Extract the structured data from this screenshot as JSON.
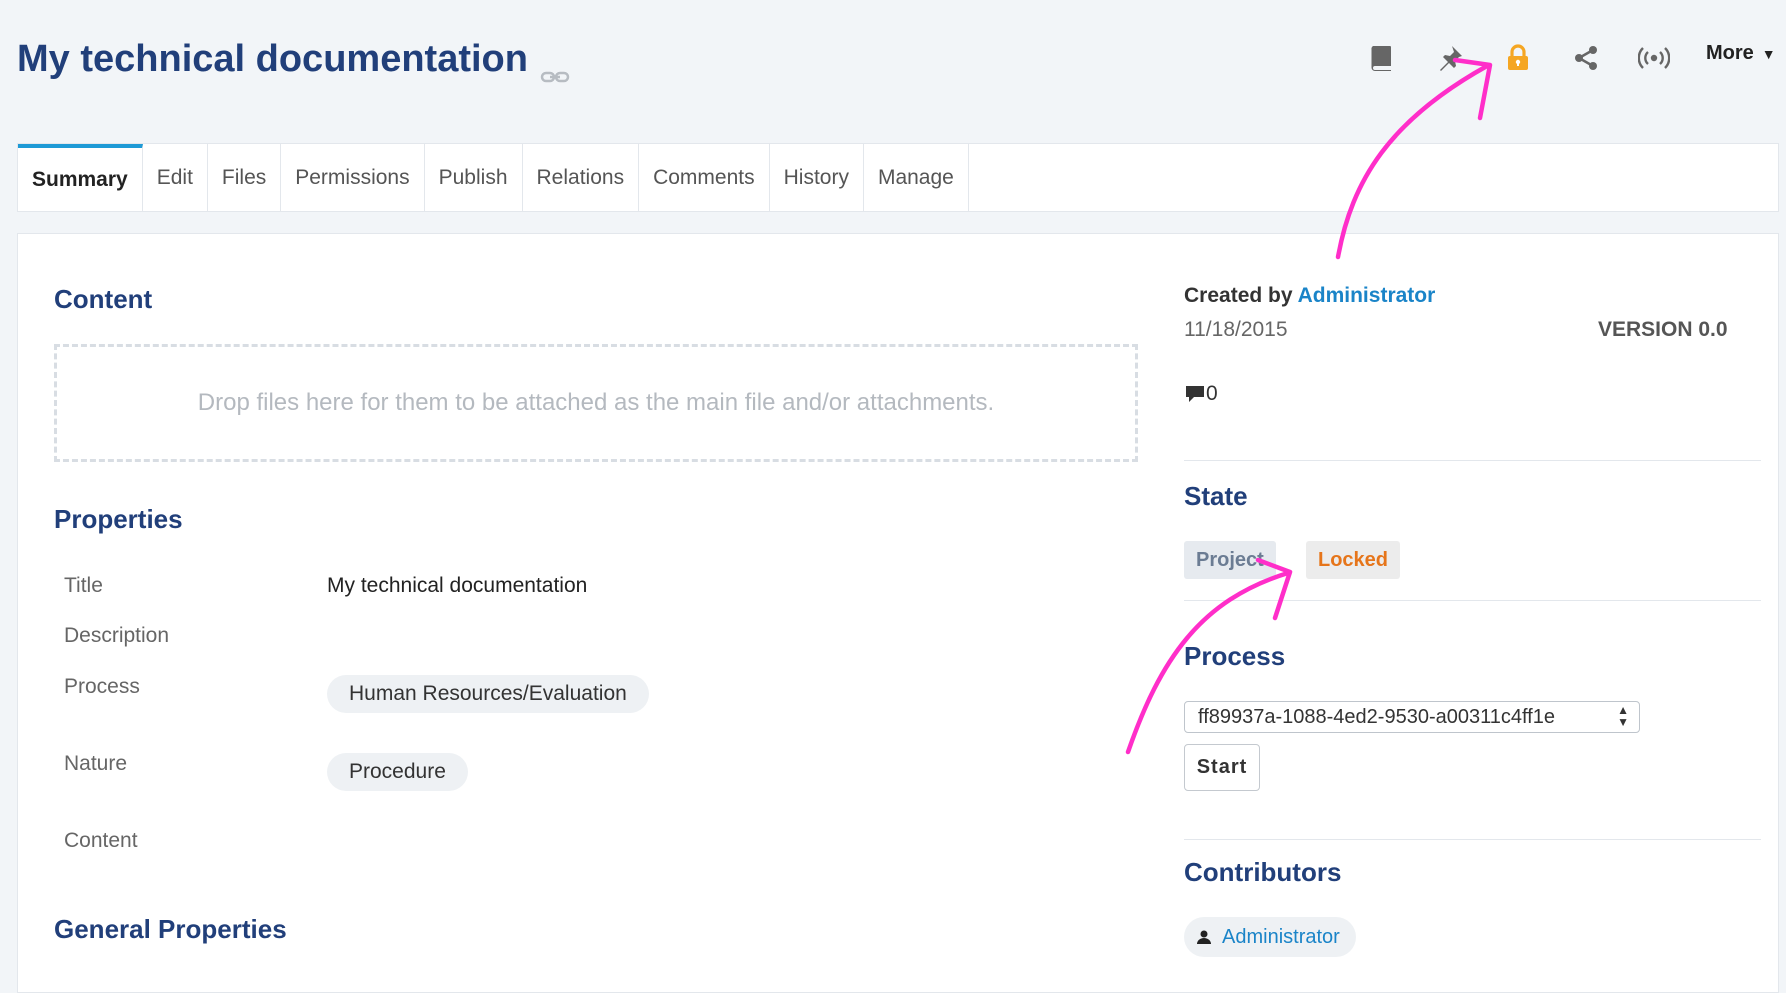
{
  "header": {
    "title": "My technical documentation",
    "more_label": "More"
  },
  "tabs": [
    {
      "label": "Summary",
      "active": true
    },
    {
      "label": "Edit"
    },
    {
      "label": "Files"
    },
    {
      "label": "Permissions"
    },
    {
      "label": "Publish"
    },
    {
      "label": "Relations"
    },
    {
      "label": "Comments"
    },
    {
      "label": "History"
    },
    {
      "label": "Manage"
    }
  ],
  "content": {
    "heading": "Content",
    "dropzone_text": "Drop files here for them to be attached as the main file and/or attachments."
  },
  "properties": {
    "heading": "Properties",
    "title_label": "Title",
    "title_value": "My technical documentation",
    "description_label": "Description",
    "process_label": "Process",
    "process_value": "Human Resources/Evaluation",
    "nature_label": "Nature",
    "nature_value": "Procedure",
    "content_label": "Content"
  },
  "general_properties": {
    "heading": "General Properties"
  },
  "info": {
    "created_by_label": "Created by",
    "created_by_user": "Administrator",
    "date": "11/18/2015",
    "version": "VERSION 0.0",
    "comment_count": "0"
  },
  "state": {
    "heading": "State",
    "badges": [
      "Project",
      "Locked"
    ]
  },
  "process": {
    "heading": "Process",
    "selected": "ff89937a-1088-4ed2-9530-a00311c4ff1e",
    "start_label": "Start"
  },
  "contributors": {
    "heading": "Contributors",
    "items": [
      "Administrator"
    ]
  },
  "icons": {
    "toolbar": [
      "book-icon",
      "pin-icon",
      "lock-icon",
      "share-icon",
      "broadcast-icon"
    ],
    "lock_color": "#f5a623",
    "annotation_color": "#ff2ec9"
  }
}
